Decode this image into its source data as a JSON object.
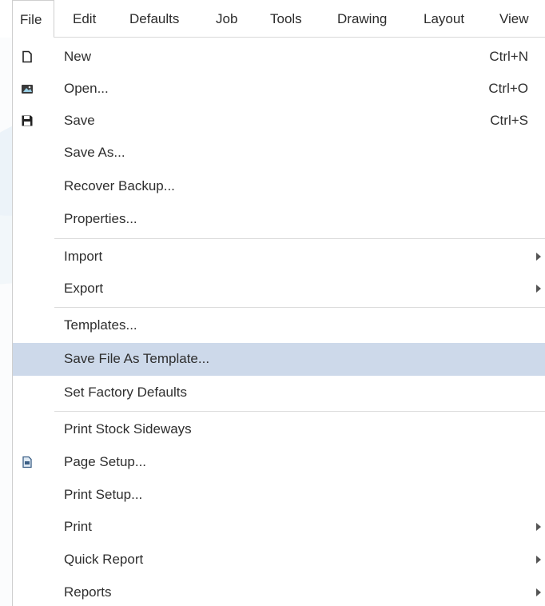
{
  "menubar": {
    "items": [
      {
        "label": "File"
      },
      {
        "label": "Edit"
      },
      {
        "label": "Defaults"
      },
      {
        "label": "Job"
      },
      {
        "label": "Tools"
      },
      {
        "label": "Drawing"
      },
      {
        "label": "Layout"
      },
      {
        "label": "View"
      }
    ],
    "active": "File"
  },
  "file_menu": {
    "items": [
      {
        "label": "New",
        "shortcut": "Ctrl+N",
        "icon": "new-document-icon"
      },
      {
        "label": "Open...",
        "shortcut": "Ctrl+O",
        "icon": "open-folder-icon"
      },
      {
        "label": "Save",
        "shortcut": "Ctrl+S",
        "icon": "save-disk-icon"
      },
      {
        "label": "Save As..."
      },
      {
        "label": "Recover Backup..."
      },
      {
        "label": "Properties..."
      },
      {
        "label": "Import",
        "submenu": true
      },
      {
        "label": "Export",
        "submenu": true
      },
      {
        "label": "Templates..."
      },
      {
        "label": "Save File As Template...",
        "highlighted": true
      },
      {
        "label": "Set Factory Defaults"
      },
      {
        "label": "Print Stock Sideways"
      },
      {
        "label": "Page Setup...",
        "icon": "page-setup-icon"
      },
      {
        "label": "Print Setup..."
      },
      {
        "label": "Print",
        "submenu": true
      },
      {
        "label": "Quick Report",
        "submenu": true
      },
      {
        "label": "Reports",
        "submenu": true
      }
    ]
  },
  "colors": {
    "highlight": "#cdd9ea",
    "separator": "#dcdcdc",
    "text": "#2e2e2e"
  }
}
